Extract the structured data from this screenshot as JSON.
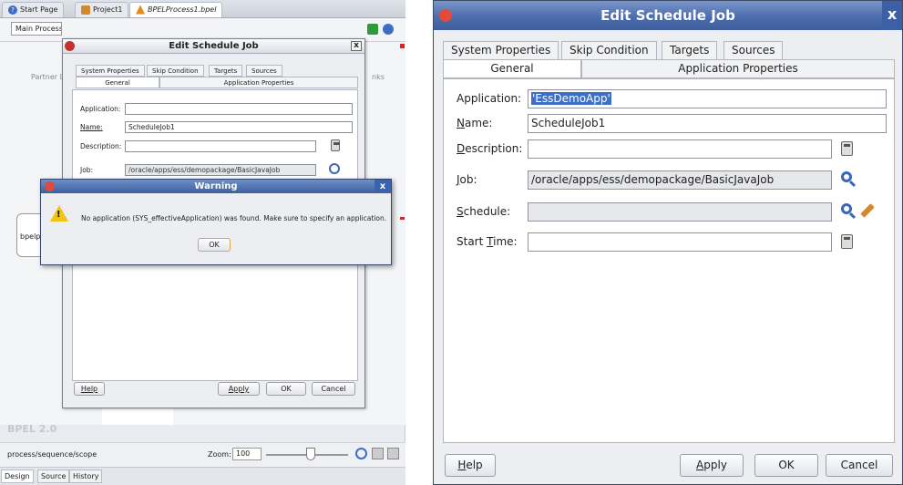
{
  "ide": {
    "tabs": [
      "Start Page",
      "Project1",
      "BPELProcess1.bpel"
    ],
    "toolbar_dropdown": "Main Process",
    "partner_label": "Partner L",
    "links_label": "nks",
    "bpel_label": "bpelp",
    "bpel_version": "BPEL 2.0",
    "path": "process/sequence/scope",
    "zoom_label": "Zoom:",
    "zoom_value": "100",
    "bottom_tabs": [
      "Design",
      "Source",
      "History"
    ]
  },
  "small_dialog": {
    "title": "Edit Schedule Job",
    "tabs_row1": [
      "System Properties",
      "Skip Condition",
      "Targets",
      "Sources"
    ],
    "tabs_row2": [
      "General",
      "Application Properties"
    ],
    "application_label": "Application:",
    "application_value": "",
    "name_label": "Name:",
    "name_value": "ScheduleJob1",
    "description_label": "Description:",
    "job_label": "Job:",
    "job_value": "/oracle/apps/ess/demopackage/BasicJavaJob",
    "help": "Help",
    "apply": "Apply",
    "ok": "OK",
    "cancel": "Cancel"
  },
  "warning": {
    "title": "Warning",
    "message": "No application (SYS_effectiveApplication) was found.  Make sure to specify an application.",
    "ok": "OK"
  },
  "big_dialog": {
    "title": "Edit Schedule Job",
    "tabs_row1": [
      "System Properties",
      "Skip Condition",
      "Targets",
      "Sources"
    ],
    "tabs_row2": [
      "General",
      "Application Properties"
    ],
    "application_label": "Application:",
    "application_value": "'EssDemoApp'",
    "name_label": "Name:",
    "name_value": "ScheduleJob1",
    "description_label": "Description:",
    "description_value": "",
    "job_label": "Job:",
    "job_value": "/oracle/apps/ess/demopackage/BasicJavaJob",
    "schedule_label": "Schedule:",
    "schedule_value": "",
    "start_time_label": "Start Time:",
    "start_time_value": "",
    "help": "Help",
    "apply": "Apply",
    "ok": "OK",
    "cancel": "Cancel"
  }
}
